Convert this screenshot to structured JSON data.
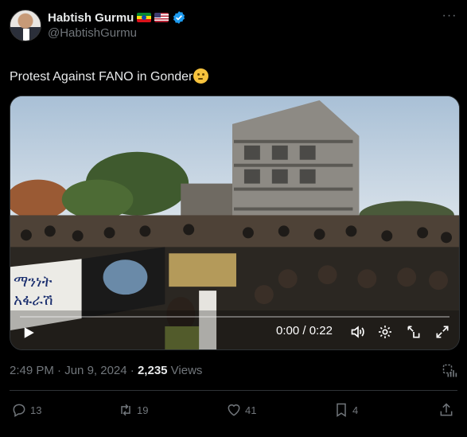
{
  "author": {
    "name": "Habtish Gurmu",
    "handle": "@HabtishGurmu",
    "flags": [
      "ethiopia-flag",
      "us-flag"
    ],
    "verified_icon": "verified-badge-icon",
    "accent": "#1d9bf0"
  },
  "tweet": {
    "text": "Protest Against FANO in Gonder",
    "emoji": "thinking-face-icon"
  },
  "video": {
    "current_time": "0:00",
    "separator": " / ",
    "duration": "0:22",
    "banner_text_line1": "ማንነት",
    "banner_text_line2": "አፋራሽ"
  },
  "meta": {
    "time": "2:49 PM",
    "dot": " · ",
    "date": "Jun 9, 2024",
    "views_count": "2,235",
    "views_label": " Views"
  },
  "actions": {
    "replies": "13",
    "reposts": "19",
    "likes": "41",
    "bookmarks": "4"
  }
}
